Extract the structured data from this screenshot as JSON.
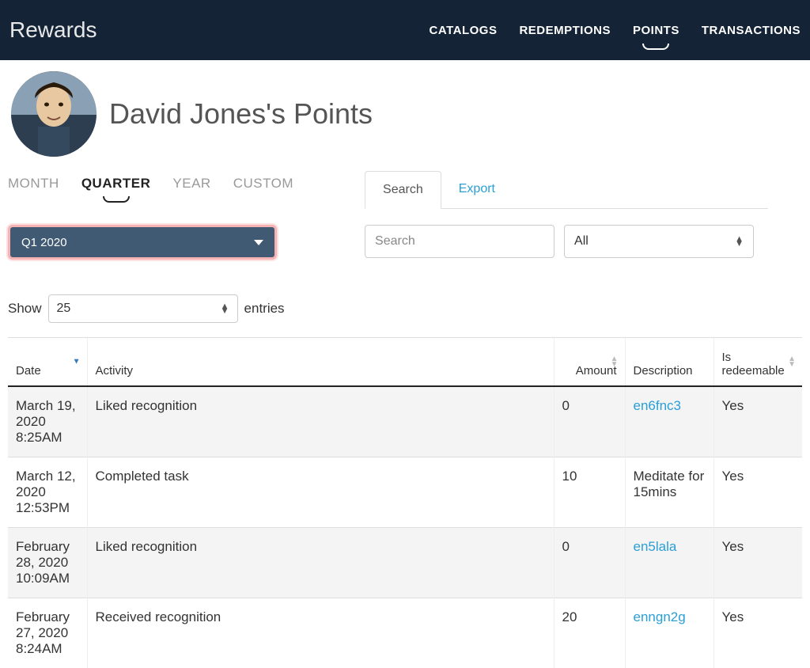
{
  "header": {
    "brand": "Rewards",
    "nav": [
      {
        "label": "CATALOGS",
        "active": false
      },
      {
        "label": "REDEMPTIONS",
        "active": false
      },
      {
        "label": "POINTS",
        "active": true
      },
      {
        "label": "TRANSACTIONS",
        "active": false
      }
    ]
  },
  "page": {
    "title": "David Jones's Points"
  },
  "period_tabs": [
    {
      "label": "MONTH",
      "active": false
    },
    {
      "label": "QUARTER",
      "active": true
    },
    {
      "label": "YEAR",
      "active": false
    },
    {
      "label": "CUSTOM",
      "active": false
    }
  ],
  "quarter_select": {
    "value": "Q1 2020"
  },
  "se_tabs": [
    {
      "label": "Search",
      "active": true
    },
    {
      "label": "Export",
      "active": false
    }
  ],
  "search": {
    "placeholder": "Search",
    "value": ""
  },
  "filter": {
    "value": "All"
  },
  "entries": {
    "show_label": "Show",
    "value": "25",
    "suffix": "entries"
  },
  "table": {
    "columns": {
      "date": "Date",
      "activity": "Activity",
      "amount": "Amount",
      "description": "Description",
      "redeemable": "Is redeemable"
    },
    "rows": [
      {
        "date": "March 19, 2020 8:25AM",
        "activity": "Liked recognition",
        "amount": "0",
        "description": "en6fnc3",
        "desc_link": true,
        "redeemable": "Yes"
      },
      {
        "date": "March 12, 2020 12:53PM",
        "activity": "Completed task",
        "amount": "10",
        "description": "Meditate for 15mins",
        "desc_link": false,
        "redeemable": "Yes"
      },
      {
        "date": "February 28, 2020 10:09AM",
        "activity": "Liked recognition",
        "amount": "0",
        "description": "en5lala",
        "desc_link": true,
        "redeemable": "Yes"
      },
      {
        "date": "February 27, 2020 8:24AM",
        "activity": "Received recognition",
        "amount": "20",
        "description": "enngn2g",
        "desc_link": true,
        "redeemable": "Yes"
      }
    ]
  }
}
